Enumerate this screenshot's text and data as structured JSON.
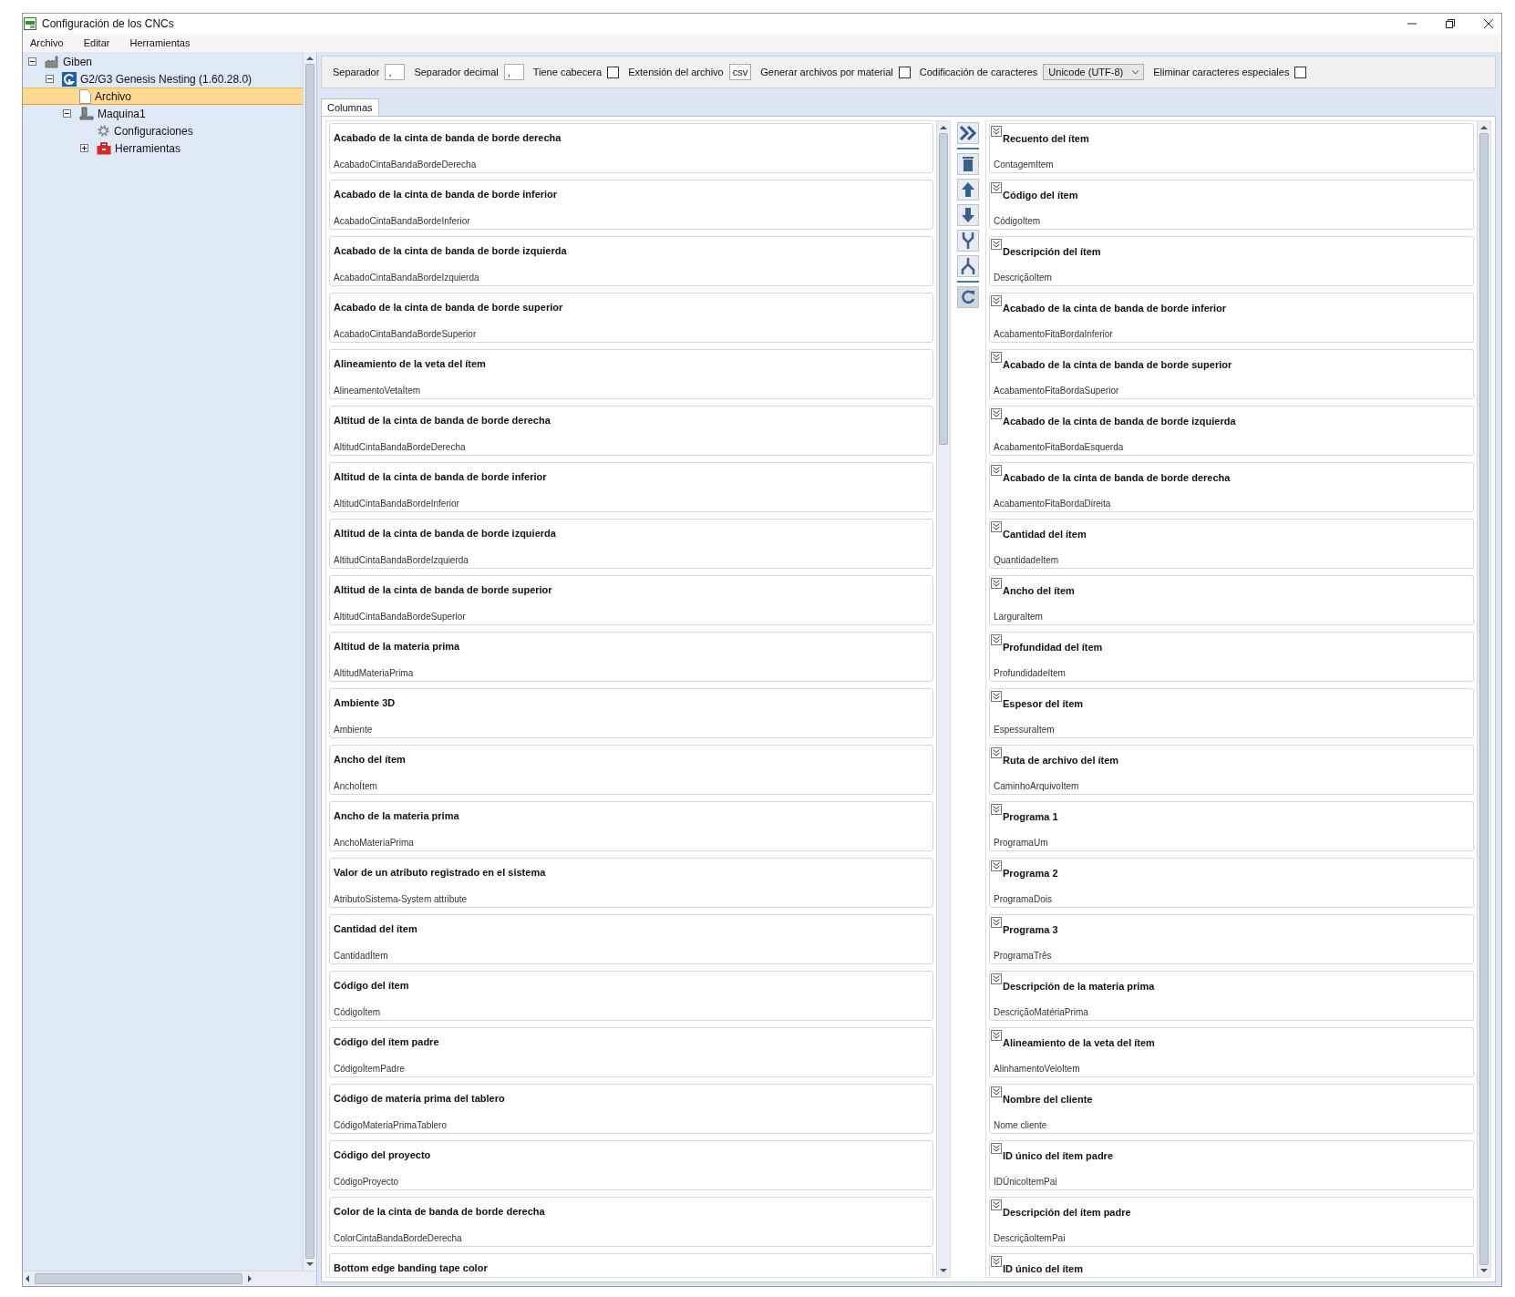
{
  "window": {
    "title": "Configuración de los CNCs"
  },
  "menu": [
    "Archivo",
    "Editar",
    "Herramientas"
  ],
  "tree": [
    {
      "label": "Giben",
      "kind": "company",
      "expanded": true,
      "selected": false,
      "children": [
        {
          "label": "G2/G3 Genesis Nesting (1.60.28.0)",
          "kind": "software",
          "expanded": true,
          "selected": false,
          "children": [
            {
              "label": "Archivo",
              "kind": "file",
              "selected": true
            },
            {
              "label": "Maquina1",
              "kind": "machine",
              "expanded": true,
              "selected": false,
              "children": [
                {
                  "label": "Configuraciones",
                  "kind": "settings",
                  "selected": false
                },
                {
                  "label": "Herramientas",
                  "kind": "toolbox",
                  "expanded": false,
                  "selected": false
                }
              ]
            }
          ]
        }
      ]
    }
  ],
  "toolbar": [
    {
      "kind": "text",
      "label": "Separador",
      "value": ","
    },
    {
      "kind": "text",
      "label": "Separador decimal",
      "value": ","
    },
    {
      "kind": "checkbox",
      "label": "Tiene cabecera",
      "checked": false
    },
    {
      "kind": "text",
      "label": "Extensión del archivo",
      "value": "csv"
    },
    {
      "kind": "checkbox",
      "label": "Generar archivos por material",
      "checked": false
    },
    {
      "kind": "select",
      "label": "Codificación de caracteres",
      "value": "Unicode (UTF-8)"
    },
    {
      "kind": "checkbox",
      "label": "Eliminar caracteres especiales",
      "checked": false
    }
  ],
  "tabs": [
    {
      "label": "Columnas",
      "selected": true
    }
  ],
  "available_columns": [
    {
      "title": "Acabado de la cinta de banda de borde derecha",
      "field": "AcabadoCintaBandaBordeDerecha"
    },
    {
      "title": "Acabado de la cinta de banda de borde inferior",
      "field": "AcabadoCintaBandaBordeInferior"
    },
    {
      "title": "Acabado de la cinta de banda de borde izquierda",
      "field": "AcabadoCintaBandaBordeIzquierda"
    },
    {
      "title": "Acabado de la cinta de banda de borde superior",
      "field": "AcabadoCintaBandaBordeSuperior"
    },
    {
      "title": "Alineamiento de la veta del ítem",
      "field": "AlineamentoVetaÍtem"
    },
    {
      "title": "Altitud de la cinta de banda de borde derecha",
      "field": "AltitudCintaBandaBordeDerecha"
    },
    {
      "title": "Altitud de la cinta de banda de borde inferior",
      "field": "AltitudCintaBandaBordeInferior"
    },
    {
      "title": "Altitud de la cinta de banda de borde izquierda",
      "field": "AltitudCintaBandaBordeIzquierda"
    },
    {
      "title": "Altitud de la cinta de banda de borde superior",
      "field": "AltitudCintaBandaBordeSuperior"
    },
    {
      "title": "Altitud de la materia prima",
      "field": "AltitudMateriaPrima"
    },
    {
      "title": "Ambiente 3D",
      "field": "Ambiente"
    },
    {
      "title": "Ancho del ítem",
      "field": "AnchoÍtem"
    },
    {
      "title": "Ancho de la materia prima",
      "field": "AnchoMateriaPrima"
    },
    {
      "title": "Valor de un atributo registrado en el sistema",
      "field": "AtributoSistema-System attribute"
    },
    {
      "title": "Cantidad del ítem",
      "field": "CantidadÍtem"
    },
    {
      "title": "Código del ítem",
      "field": "CódigoÍtem"
    },
    {
      "title": "Código del ítem padre",
      "field": "CódigoÍtemPadre"
    },
    {
      "title": "Código de materia prima del tablero",
      "field": "CódigoMateriaPrimaTablero"
    },
    {
      "title": "Código del proyecto",
      "field": "CódigoProyecto"
    },
    {
      "title": "Color de la cinta de banda de borde derecha",
      "field": "ColorCintaBandaBordeDerecha"
    },
    {
      "title": "Bottom edge banding tape color"
    }
  ],
  "selected_columns": [
    {
      "title": "Recuento del ítem",
      "field": "ContagemItem"
    },
    {
      "title": "Código del ítem",
      "field": "CódigoItem"
    },
    {
      "title": "Descripción del ítem",
      "field": "DescriçãoItem"
    },
    {
      "title": "Acabado de la cinta de banda de borde inferior",
      "field": "AcabamentoFitaBordaInferior"
    },
    {
      "title": "Acabado de la cinta de banda de borde superior",
      "field": "AcabamentoFitaBordaSuperior"
    },
    {
      "title": "Acabado de la cinta de banda de borde izquierda",
      "field": "AcabamentoFitaBordaEsquerda"
    },
    {
      "title": "Acabado de la cinta de banda de borde derecha",
      "field": "AcabamentoFitaBordaDireita"
    },
    {
      "title": "Cantidad del ítem",
      "field": "QuantidadeItem"
    },
    {
      "title": "Ancho del ítem",
      "field": "LarguraItem"
    },
    {
      "title": "Profundidad del ítem",
      "field": "ProfundidadeItem"
    },
    {
      "title": "Espesor del ítem",
      "field": "EspessuraItem"
    },
    {
      "title": "Ruta de archivo del ítem",
      "field": "CaminhoArquivoItem"
    },
    {
      "title": "Programa 1",
      "field": "ProgramaUm"
    },
    {
      "title": "Programa 2",
      "field": "ProgramaDois"
    },
    {
      "title": "Programa 3",
      "field": "ProgramaTrês"
    },
    {
      "title": "Descripción de la materia prima",
      "field": "DescriçãoMatériaPrima"
    },
    {
      "title": "Alineamiento de la veta del ítem",
      "field": "AlinhamentoVeioItem"
    },
    {
      "title": "Nombre del cliente",
      "field": "Nome cliente"
    },
    {
      "title": "ID único del ítem padre",
      "field": "IDÚnicoItemPai"
    },
    {
      "title": "Descripción del ítem padre",
      "field": "DescriçãoItemPai"
    },
    {
      "title": "ID único del ítem"
    }
  ]
}
